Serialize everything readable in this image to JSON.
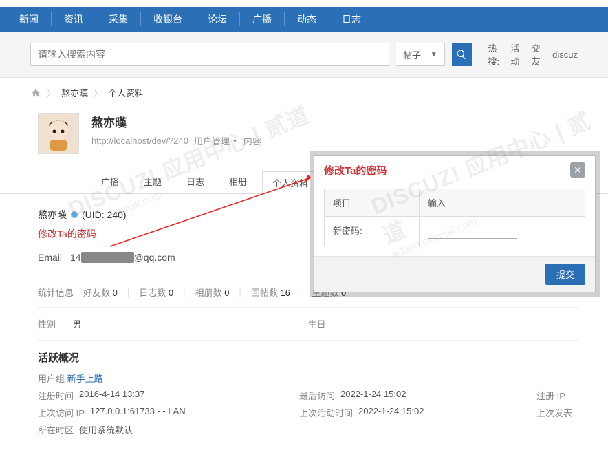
{
  "nav": [
    "新闻",
    "资讯",
    "采集",
    "收银台",
    "论坛",
    "广播",
    "动态",
    "日志"
  ],
  "search": {
    "placeholder": "请输入搜索内容",
    "type": "帖子",
    "hotlabel": "热搜:",
    "hots": [
      "活动",
      "交友",
      "discuz"
    ]
  },
  "crumb": {
    "c1": "熬亦暵",
    "c2": "个人资料"
  },
  "profile": {
    "name": "熬亦暵",
    "url": "http://localhost/dev/?240",
    "manager": "用户管理",
    "extra": "内容",
    "tabs": [
      "广播",
      "主题",
      "日志",
      "相册",
      "个人资料"
    ],
    "active_tab": 4,
    "uidline_a": "熬亦暵",
    "uidline_b": "(UID: 240)",
    "change_pw": "修改Ta的密码",
    "email_k": "Email",
    "email_v1": "14",
    "email_v2": "@qq.com",
    "stats_label": "统计信息",
    "stats": [
      {
        "k": "好友数",
        "v": "0"
      },
      {
        "k": "日志数",
        "v": "0"
      },
      {
        "k": "相册数",
        "v": "0"
      },
      {
        "k": "回帖数",
        "v": "16"
      },
      {
        "k": "主题数",
        "v": "0"
      }
    ],
    "gender_k": "性别",
    "gender_v": "男",
    "birth_k": "生日",
    "birth_v": "-",
    "activity_title": "活跃概况",
    "usergroup_k": "用户组",
    "usergroup_v": "新手上路",
    "rows": [
      {
        "k": "注册时间",
        "v": "2016-4-14 13:37"
      },
      {
        "k": "最后访问",
        "v": "2022-1-24 15:02"
      },
      {
        "k": "注册 IP",
        "v": ""
      },
      {
        "k": "上次访问 IP",
        "v": "127.0.0.1:61733 - - LAN"
      },
      {
        "k": "上次活动时间",
        "v": "2022-1-24 15:02"
      },
      {
        "k": "上次发表",
        "v": ""
      },
      {
        "k": "所在时区",
        "v": "使用系统默认"
      }
    ]
  },
  "modal": {
    "title": "修改Ta的密码",
    "col1": "项目",
    "col2": "输入",
    "field": "新密码:",
    "submit": "提交"
  },
  "watermark": {
    "main": "DISCUZ! 应用中心 | 贰道",
    "sub": "addon.dismall.com"
  }
}
